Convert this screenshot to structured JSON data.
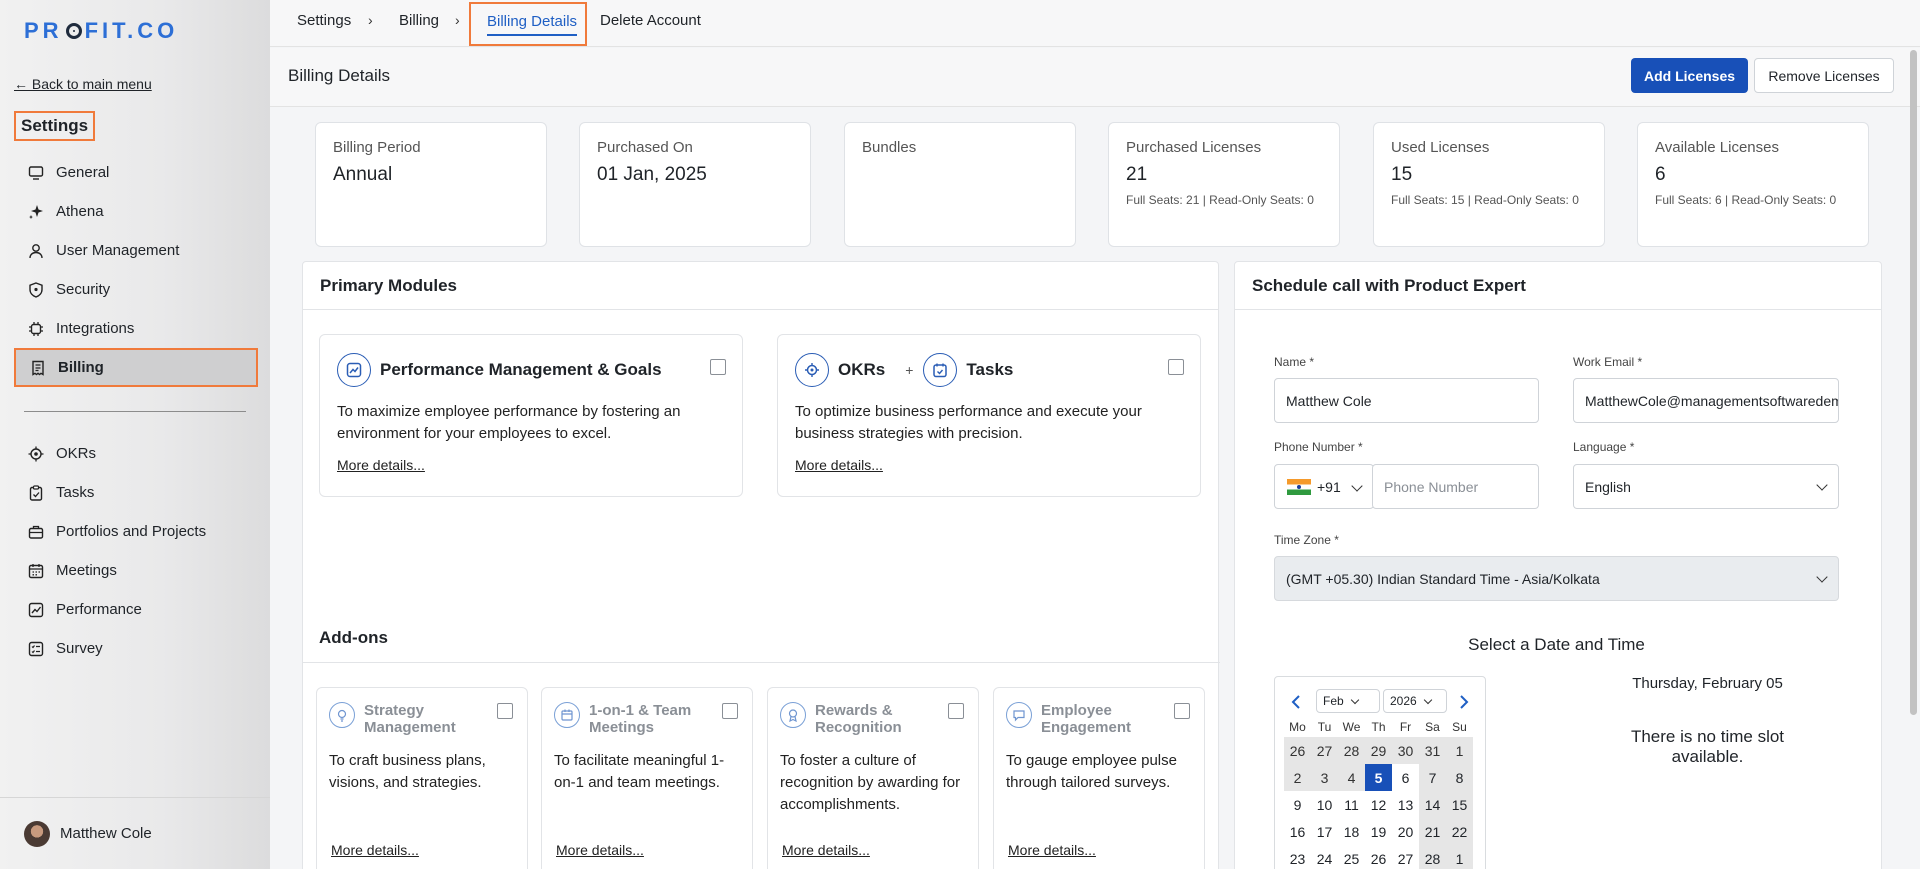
{
  "brand": {
    "logo": "PROFIT.CO"
  },
  "sidebar": {
    "back_link": "← Back to main menu",
    "title": "Settings",
    "items": [
      {
        "label": "General",
        "icon": "monitor-icon"
      },
      {
        "label": "Athena",
        "icon": "sparkle-icon"
      },
      {
        "label": "User Management",
        "icon": "user-icon"
      },
      {
        "label": "Security",
        "icon": "shield-icon"
      },
      {
        "label": "Integrations",
        "icon": "chip-icon"
      },
      {
        "label": "Billing",
        "icon": "receipt-icon",
        "active": true
      }
    ],
    "apps": [
      {
        "label": "OKRs",
        "icon": "target-icon"
      },
      {
        "label": "Tasks",
        "icon": "clipboard-icon"
      },
      {
        "label": "Portfolios and Projects",
        "icon": "briefcase-icon"
      },
      {
        "label": "Meetings",
        "icon": "calendar-icon"
      },
      {
        "label": "Performance",
        "icon": "chart-icon"
      },
      {
        "label": "Survey",
        "icon": "survey-icon"
      }
    ],
    "user": {
      "name": "Matthew Cole"
    }
  },
  "breadcrumb": {
    "items": [
      "Settings",
      "Billing"
    ],
    "active": "Billing Details",
    "extra": "Delete Account",
    "separator": "›"
  },
  "header": {
    "title": "Billing Details",
    "add_button": "Add Licenses",
    "remove_button": "Remove Licenses"
  },
  "stats": [
    {
      "label": "Billing Period",
      "value": "Annual",
      "sub": ""
    },
    {
      "label": "Purchased On",
      "value": "01 Jan, 2025",
      "sub": ""
    },
    {
      "label": "Bundles",
      "value": "",
      "sub": ""
    },
    {
      "label": "Purchased Licenses",
      "value": "21",
      "sub": "Full Seats: 21 | Read-Only Seats: 0"
    },
    {
      "label": "Used Licenses",
      "value": "15",
      "sub": "Full Seats: 15 | Read-Only Seats: 0"
    },
    {
      "label": "Available Licenses",
      "value": "6",
      "sub": "Full Seats: 6 | Read-Only Seats: 0"
    }
  ],
  "primary_modules": {
    "title": "Primary Modules",
    "cards": [
      {
        "title": "Performance Management & Goals",
        "desc": "To maximize employee performance by fostering an environment for your employees to excel.",
        "more": "More details..."
      },
      {
        "title_a": "OKRs",
        "plus": "+",
        "title_b": "Tasks",
        "desc": "To optimize business performance and execute your business strategies with precision.",
        "more": "More details..."
      }
    ]
  },
  "addons": {
    "title": "Add-ons",
    "cards": [
      {
        "title": "Strategy Management",
        "desc": "To craft business plans, visions, and strategies.",
        "more": "More details..."
      },
      {
        "title": "1-on-1 & Team Meetings",
        "desc": "To facilitate meaningful 1-on-1 and team meetings.",
        "more": "More details..."
      },
      {
        "title": "Rewards & Recognition",
        "desc": "To foster a culture of recognition by awarding for accomplishments.",
        "more": "More details..."
      },
      {
        "title": "Employee Engagement",
        "desc": "To gauge employee pulse through tailored surveys.",
        "more": "More details..."
      }
    ]
  },
  "schedule": {
    "title": "Schedule call with Product Expert",
    "name_label": "Name *",
    "name_value": "Matthew  Cole",
    "email_label": "Work Email *",
    "email_value": "MatthewCole@managementsoftwaredemo.com",
    "phone_label": "Phone Number *",
    "phone_code": "+91",
    "phone_placeholder": "Phone Number",
    "language_label": "Language *",
    "language_value": "English",
    "tz_label": "Time Zone *",
    "tz_value": "(GMT +05.30) Indian Standard Time - Asia/Kolkata",
    "select_title": "Select a Date and Time",
    "selected_day": "Thursday, February 05",
    "no_slot": "There is no time slot available.",
    "calendar": {
      "month": "Feb",
      "year": "2026",
      "prev": "‹",
      "next": "›",
      "weekdays": [
        "Mo",
        "Tu",
        "We",
        "Th",
        "Fr",
        "Sa",
        "Su"
      ],
      "weeks": [
        [
          "26",
          "27",
          "28",
          "29",
          "30",
          "31",
          "1"
        ],
        [
          "2",
          "3",
          "4",
          "5",
          "6",
          "7",
          "8"
        ],
        [
          "9",
          "10",
          "11",
          "12",
          "13",
          "14",
          "15"
        ],
        [
          "16",
          "17",
          "18",
          "19",
          "20",
          "21",
          "22"
        ],
        [
          "23",
          "24",
          "25",
          "26",
          "27",
          "28",
          "1"
        ]
      ],
      "selected": "5"
    }
  }
}
